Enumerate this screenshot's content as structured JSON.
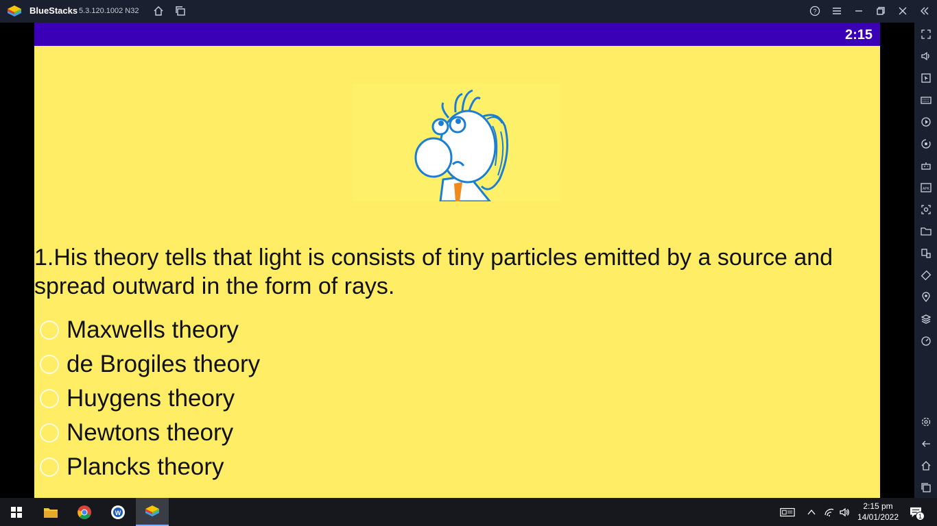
{
  "window": {
    "app_name": "BlueStacks",
    "version": "5.3.120.1002 N32"
  },
  "quiz": {
    "timer": "2:15",
    "question": "1.His theory tells that light is consists of tiny particles emitted by a source and spread outward in the form of rays.",
    "options": [
      "Maxwells theory",
      "de Brogiles theory",
      "Huygens theory",
      "Newtons theory",
      "Plancks theory"
    ]
  },
  "taskbar": {
    "time": "2:15 pm",
    "date": "14/01/2022",
    "notification_count": "1"
  },
  "colors": {
    "app_bar": "#3a00b8",
    "background": "#ffed66",
    "titlebar": "#1b2030"
  }
}
